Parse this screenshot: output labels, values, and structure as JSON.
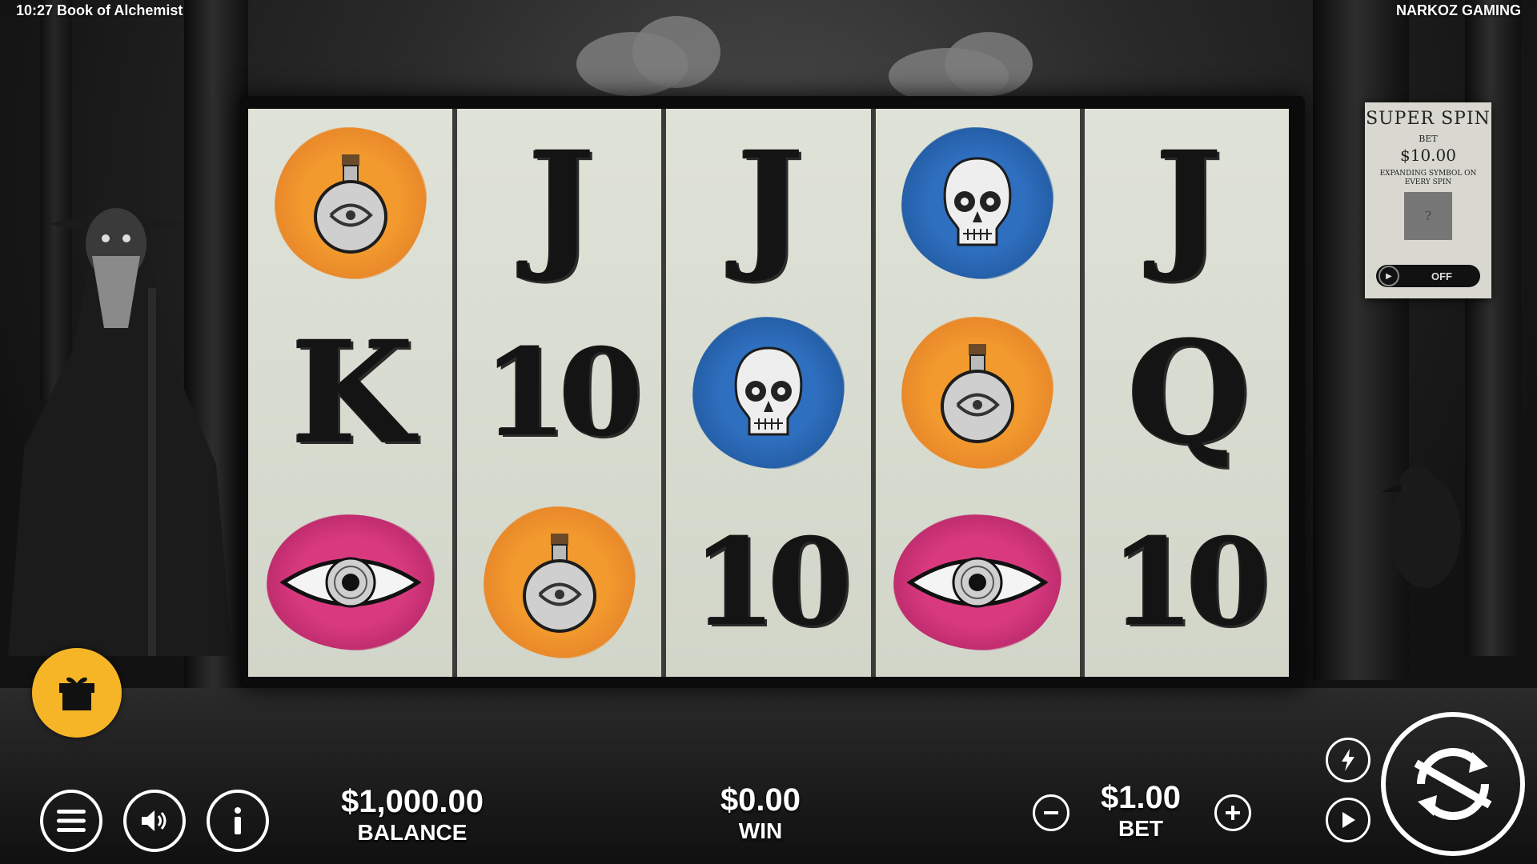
{
  "header": {
    "clock_title": "10:27 Book of Alchemist",
    "provider": "NARKOZ GAMING"
  },
  "reels": [
    [
      "potion",
      "K",
      "eye"
    ],
    [
      "J",
      "10",
      "potion"
    ],
    [
      "J",
      "skull",
      "10"
    ],
    [
      "skull",
      "potion",
      "eye"
    ],
    [
      "J",
      "Q",
      "10"
    ]
  ],
  "symbol_colors": {
    "potion": "#f29a2e",
    "skull": "#2f6fbf",
    "eye": "#d93a7e"
  },
  "super_spin": {
    "title": "SUPER SPIN",
    "bet_label": "BET",
    "bet_value": "$10.00",
    "description": "EXPANDING SYMBOL ON EVERY SPIN",
    "mystery_symbol": "?",
    "toggle_state": "OFF"
  },
  "gift_button": {
    "icon": "gift-icon",
    "color": "#f6b526"
  },
  "bottom_bar": {
    "balance_value": "$1,000.00",
    "balance_label": "BALANCE",
    "win_value": "$0.00",
    "win_label": "WIN",
    "bet_value": "$1.00",
    "bet_label": "BET",
    "menu_icon": "menu-icon",
    "sound_icon": "speaker-icon",
    "info_icon": "info-icon",
    "turbo_icon": "lightning-icon",
    "autoplay_icon": "play-icon",
    "spin_icon": "spin-arrows-icon"
  }
}
